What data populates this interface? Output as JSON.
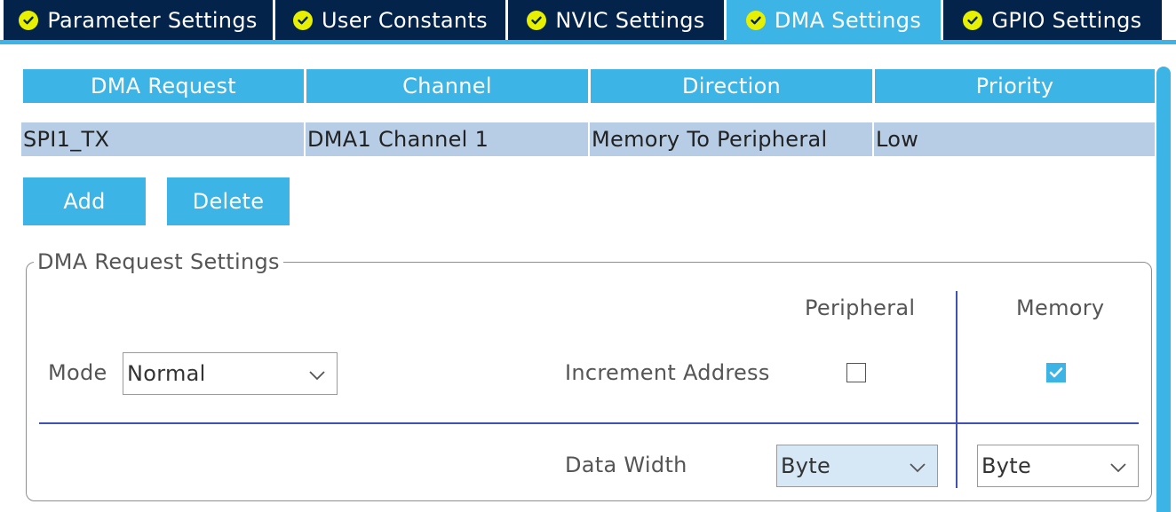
{
  "tabs": [
    {
      "label": "Parameter Settings",
      "active": false
    },
    {
      "label": "User Constants",
      "active": false
    },
    {
      "label": "NVIC Settings",
      "active": false
    },
    {
      "label": "DMA Settings",
      "active": true
    },
    {
      "label": "GPIO Settings",
      "active": false
    }
  ],
  "dma_table": {
    "columns": [
      "DMA Request",
      "Channel",
      "Direction",
      "Priority"
    ],
    "rows": [
      [
        "SPI1_TX",
        "DMA1 Channel 1",
        "Memory To Peripheral",
        "Low"
      ]
    ]
  },
  "buttons": {
    "add": "Add",
    "delete": "Delete"
  },
  "request_settings": {
    "legend": "DMA Request Settings",
    "mode_label": "Mode",
    "mode_value": "Normal",
    "peripheral_header": "Peripheral",
    "memory_header": "Memory",
    "increment_label": "Increment Address",
    "increment_peripheral": false,
    "increment_memory": true,
    "data_width_label": "Data Width",
    "data_width_peripheral": "Byte",
    "data_width_memory": "Byte"
  },
  "colors": {
    "tab_background": "#03234b",
    "accent": "#3cb4e6",
    "tab_check": "#e6f000",
    "selected_row": "#b7cde5",
    "divider": "#3f51b5"
  },
  "icons": {
    "tab_status": "check-circle-icon",
    "dropdown": "chevron-down-icon",
    "checkbox_checked": "checkmark-icon"
  }
}
